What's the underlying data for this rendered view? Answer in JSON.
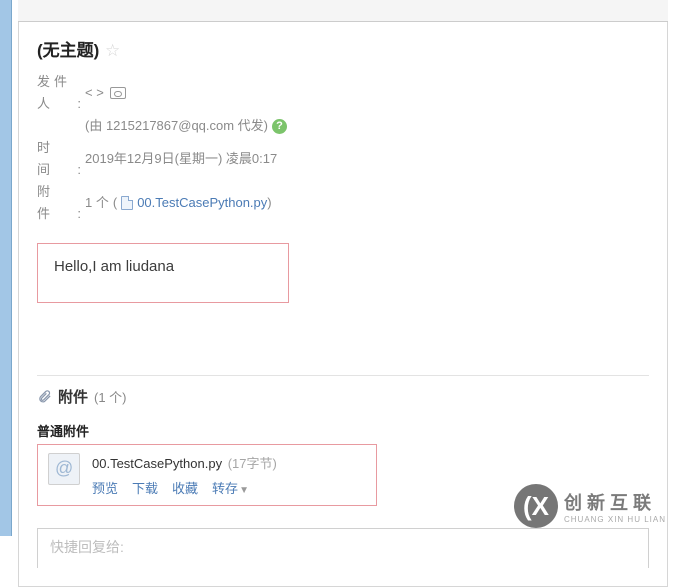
{
  "subject": "(无主题)",
  "meta": {
    "sender_label": "发件人:",
    "sender_value": "< >",
    "proxy_line": "(由 1215217867@qq.com 代发)",
    "time_label": "时　间:",
    "time_value": "2019年12月9日(星期一) 凌晨0:17",
    "attach_label": "附　件:",
    "attach_count_text": "1 个",
    "attach_link_prefix": "(",
    "attach_link_name": "00.TestCasePython.py",
    "attach_link_suffix": ")"
  },
  "body": {
    "content": "Hello,I am liudana"
  },
  "attach_section": {
    "header": "附件",
    "header_count": "(1 个)",
    "sub_header": "普通附件",
    "item": {
      "name": "00.TestCasePython.py",
      "size": "(17字节)",
      "ops": {
        "preview": "预览",
        "download": "下载",
        "favorite": "收藏",
        "forward": "转存"
      }
    }
  },
  "reply": {
    "placeholder": "快捷回复给:"
  },
  "watermark": {
    "glyph": "(X",
    "line1": "创新互联",
    "line2": "CHUANG XIN HU LIAN"
  }
}
